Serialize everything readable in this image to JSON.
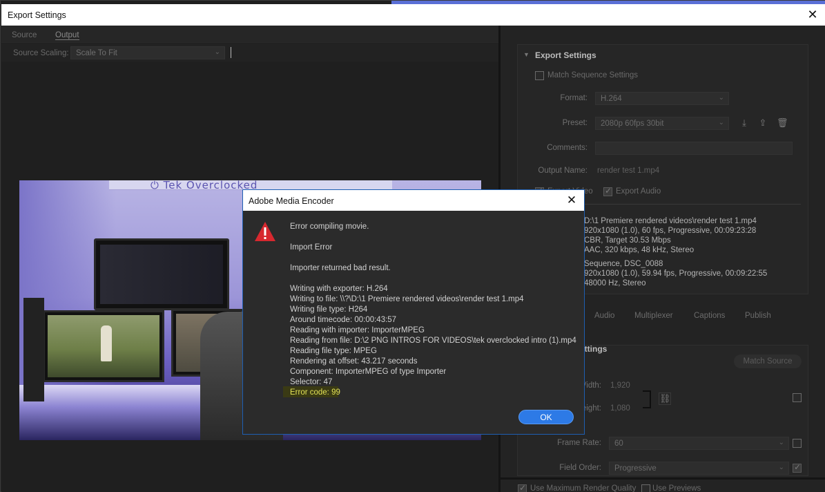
{
  "window": {
    "title": "Export Settings",
    "close_glyph": "✕"
  },
  "left_panel": {
    "tabs": [
      "Source",
      "Output"
    ],
    "active_tab": "Output",
    "source_scaling_label": "Source Scaling:",
    "source_scaling_value": "Scale To Fit",
    "preview_banner_text": "⏻ Tek Overclocked"
  },
  "export_settings": {
    "section_title": "Export Settings",
    "match_sequence_label": "Match Sequence Settings",
    "match_sequence_checked": false,
    "format_label": "Format:",
    "format_value": "H.264",
    "preset_label": "Preset:",
    "preset_value": "2080p 60fps 30bit",
    "comments_label": "Comments:",
    "comments_value": "",
    "output_name_label": "Output Name:",
    "output_name_value": "render test 1.mp4",
    "export_video_label": "Export Video",
    "export_video_checked": true,
    "export_audio_label": "Export Audio",
    "export_audio_checked": true,
    "output_summary": [
      "D:\\1 Premiere rendered videos\\render test 1.mp4",
      "920x1080 (1.0), 60 fps, Progressive, 00:09:23:28",
      "CBR, Target 30.53 Mbps",
      "AAC, 320 kbps, 48 kHz, Stereo"
    ],
    "source_summary": [
      "Sequence, DSC_0088",
      "920x1080 (1.0), 59.94 fps, Progressive, 00:09:22:55",
      "48000 Hz, Stereo"
    ]
  },
  "lower_tabs": [
    "Audio",
    "Multiplexer",
    "Captions",
    "Publish"
  ],
  "video_settings": {
    "section_title_fragment": "ettings",
    "match_source_label": "Match Source",
    "width_label_fragment": "Vidth:",
    "width_value": "1,920",
    "height_label_fragment": "eight:",
    "height_value": "1,080",
    "frame_rate_label": "Frame Rate:",
    "frame_rate_value": "60",
    "field_order_label": "Field Order:",
    "field_order_value": "Progressive",
    "max_render_label": "Use Maximum Render Quality",
    "use_previews_label": "Use Previews"
  },
  "dialog": {
    "title": "Adobe Media Encoder",
    "icon": "warning-icon",
    "lines": [
      "Error compiling movie.",
      "Import Error",
      "Importer returned bad result.",
      "Writing with exporter: H.264",
      "Writing to file: \\\\?\\D:\\1 Premiere rendered videos\\render test 1.mp4",
      "Writing file type: H264",
      "Around timecode: 00:00:43:57",
      "Reading with importer: ImporterMPEG",
      "Reading from file: D:\\2 PNG INTROS FOR VIDEOS\\tek overclocked intro (1).mp4",
      "Reading file type: MPEG",
      "Rendering at offset: 43.217 seconds",
      "Component: ImporterMPEG of type Importer",
      "Selector: 47",
      "Error code: 99"
    ],
    "ok_label": "OK"
  },
  "colors": {
    "accent_blue": "#2d7ae6",
    "error_highlight": "#e3e356",
    "warning_red": "#d7282f"
  }
}
